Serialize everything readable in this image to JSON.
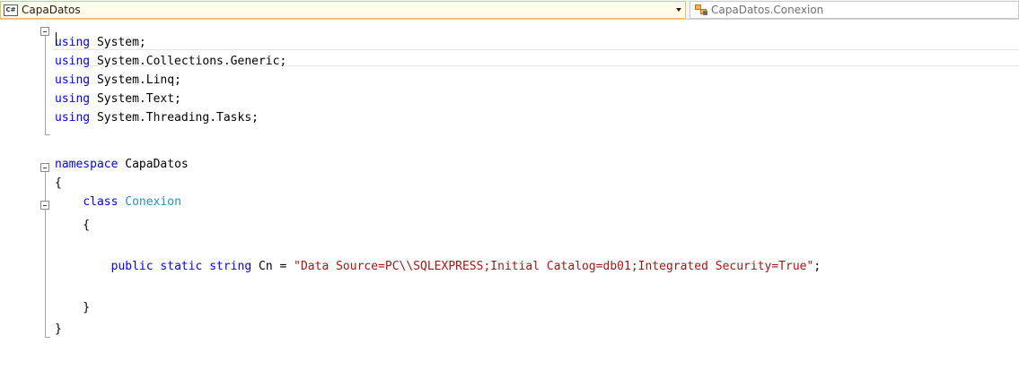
{
  "navbar": {
    "project_badge": "C#",
    "project_name": "CapaDatos",
    "member_name": "CapaDatos.Conexion"
  },
  "code": {
    "l1_kw": "using",
    "l1_rest": " System;",
    "l2_kw": "using",
    "l2_rest": " System.Collections.Generic;",
    "l3_kw": "using",
    "l3_rest": " System.Linq;",
    "l4_kw": "using",
    "l4_rest": " System.Text;",
    "l5_kw": "using",
    "l5_rest": " System.Threading.Tasks;",
    "l7_kw": "namespace",
    "l7_rest": " CapaDatos",
    "l8": "{",
    "l9_indent": "    ",
    "l9_kw": "class",
    "l9_type": "Conexion",
    "l10": "    {",
    "l12_indent": "        ",
    "l12_kw": "public static string",
    "l12_mid": " Cn = ",
    "l12_str": "\"Data Source=PC\\\\SQLEXPRESS;Initial Catalog=db01;Integrated Security=True\"",
    "l12_end": ";",
    "l14": "    }",
    "l15": "}"
  },
  "colors": {
    "keyword": "#0000ff",
    "type": "#2b91af",
    "string": "#a31515",
    "text": "#000000"
  }
}
